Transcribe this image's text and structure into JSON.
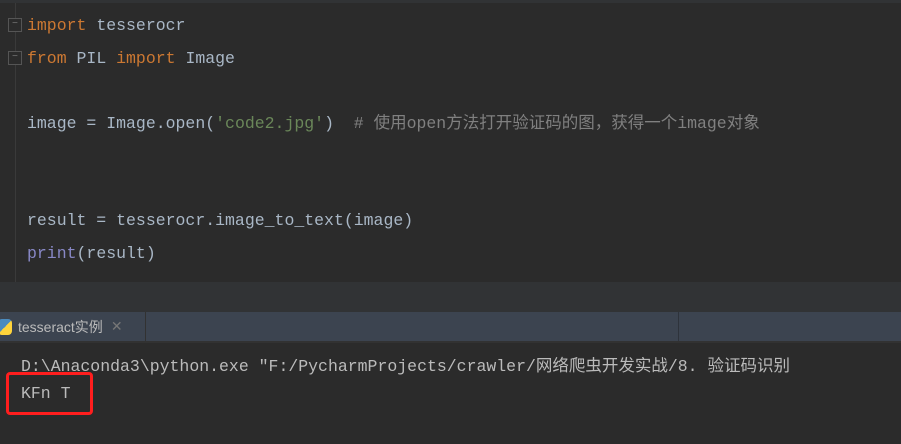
{
  "editor": {
    "lines": [
      {
        "kw1": "import",
        "rest": " tesserocr"
      },
      {
        "kw1": "from",
        "mid": " PIL ",
        "kw2": "import",
        "rest": " Image"
      },
      {
        "pre": "image = Image.open(",
        "str": "'code2.jpg'",
        "post": ")  ",
        "comment": "# 使用open方法打开验证码的图，获得一个image对象"
      },
      {
        "text": "result = tesserocr.image_to_text(image)"
      },
      {
        "bi": "print",
        "rest": "(result)"
      }
    ]
  },
  "console": {
    "tab_label": "tesseract实例",
    "close_symbol": "✕",
    "command": "D:\\Anaconda3\\python.exe \"F:/PycharmProjects/crawler/网络爬虫开发实战/8. 验证码识别",
    "output": "KFn T"
  },
  "colors": {
    "highlight": "#ff1e1e",
    "keyword": "#cc7832",
    "string": "#6a8759",
    "comment": "#808080"
  }
}
